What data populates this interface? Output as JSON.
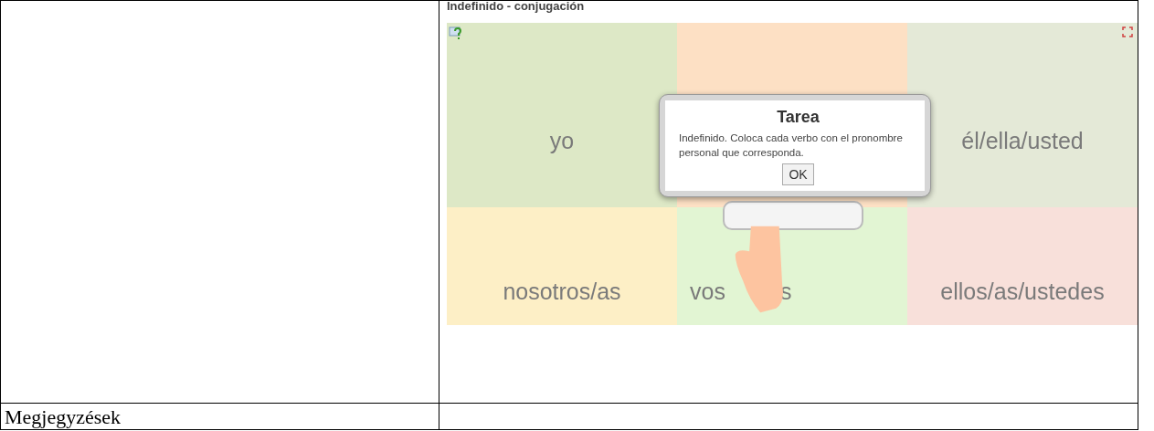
{
  "app": {
    "title": "Indefinido - conjugación",
    "cells": [
      {
        "texts": [
          "yo"
        ],
        "color": "#dde8c6"
      },
      {
        "color": "#fde0c4"
      },
      {
        "texts": [
          "él/ella/usted"
        ],
        "color": "#e4e9d7"
      },
      {
        "texts": [
          "nosotros/as"
        ],
        "color": "#fdefc6"
      },
      {
        "texts": [
          "vos",
          "s"
        ],
        "color": "#e2f5d3"
      },
      {
        "texts": [
          "ellos/as/ustedes"
        ],
        "color": "#f8e0da"
      }
    ],
    "dialog": {
      "title": "Tarea",
      "message": "Indefinido. Coloca cada verbo con el pronombre personal que corresponda.",
      "button": "OK"
    }
  },
  "notes_label": "Megjegyzések"
}
